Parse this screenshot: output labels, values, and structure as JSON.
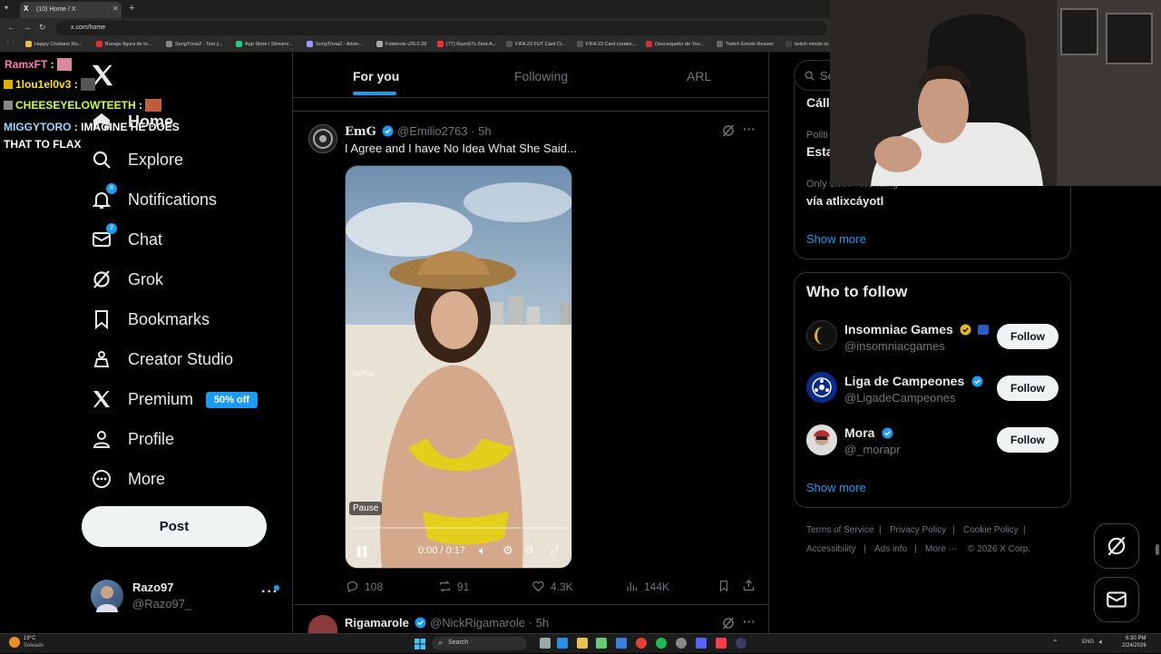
{
  "browser": {
    "tab_title": "(10) Home / X",
    "url": "x.com/home",
    "bookmarks": [
      "Happy Cristiano Ro...",
      "Burago figura de to...",
      "SongTrivia2 - Test y...",
      "App Store / Streami...",
      "SongTrivia2 - Advin...",
      "Futetools v26.0.28",
      "(77) Razo97s Zest-A...",
      "FIFA 23 FUT Card Cr...",
      "FIFA 23 Card creator...",
      "Descargador de You...",
      "Twitch Emote Resizer",
      "twitch emote re..."
    ]
  },
  "chat": [
    {
      "user": "RamxFT",
      "color": "#ff7ab6",
      "message": ""
    },
    {
      "user": "1lou1el0v3",
      "color": "#ffe000",
      "message": ""
    },
    {
      "user": "CHEESEYELOWTEETH",
      "color": "#c8ff40",
      "message": ""
    },
    {
      "user": "MIGGYTORO",
      "color": "#9ad8ff",
      "message": "IMAGINE HE DOES THAT TO FLAX"
    }
  ],
  "nav": {
    "home": "Home",
    "explore": "Explore",
    "notifications": "Notifications",
    "notifications_badge": "8",
    "chat": "Chat",
    "chat_badge": "2",
    "grok": "Grok",
    "bookmarks": "Bookmarks",
    "creator_studio": "Creator Studio",
    "premium": "Premium",
    "premium_promo": "50% off",
    "profile": "Profile",
    "more": "More",
    "post_button": "Post"
  },
  "account": {
    "name": "Razo97",
    "handle": "@Razo97_"
  },
  "feed_tabs": [
    "For you",
    "Following",
    "ARL"
  ],
  "post": {
    "author": "EmG",
    "handle": "@Emilio2763",
    "time": "5h",
    "text": "I Agree and I have No Idea What She Said...",
    "video": {
      "pause_label": "Pause",
      "time": "0:00 / 0:17",
      "watermark": "TikTok",
      "progress": 0.0
    },
    "replies": "108",
    "reposts": "91",
    "likes": "4.3K",
    "views": "144K"
  },
  "next_post": {
    "author": "Rigamarole",
    "handle": "@NickRigamarole",
    "time": "5h"
  },
  "trends": {
    "item1_title": "Cáll",
    "item2_context": "Politi",
    "item2_title": "Esta",
    "item3_context": "Only on X · Trending",
    "item3_title": "vía atlixcáyotl",
    "show_more": "Show more"
  },
  "who_to_follow": {
    "title": "Who to follow",
    "accounts": [
      {
        "name": "Insomniac Games",
        "handle": "@insomniacgames",
        "button": "Follow"
      },
      {
        "name": "Liga de Campeones",
        "handle": "@LigadeCampeones",
        "button": "Follow"
      },
      {
        "name": "Mora",
        "handle": "@_morapr",
        "button": "Follow"
      }
    ],
    "show_more": "Show more"
  },
  "footer": {
    "links": [
      "Terms of Service",
      "Privacy Policy",
      "Cookie Policy",
      "Accessibility",
      "Ads info",
      "More ···"
    ],
    "copyright": "© 2026 X Corp."
  },
  "search_placeholder": "Se",
  "taskbar": {
    "weather_temp": "19°C",
    "weather_desc": "Soleado",
    "search": "Search",
    "lang": "ENG",
    "time": "6:30 PM",
    "date": "2/24/2026"
  },
  "colors": {
    "accent": "#1d9bf0",
    "background": "#000000",
    "border": "#2f3336",
    "muted": "#71767b"
  }
}
